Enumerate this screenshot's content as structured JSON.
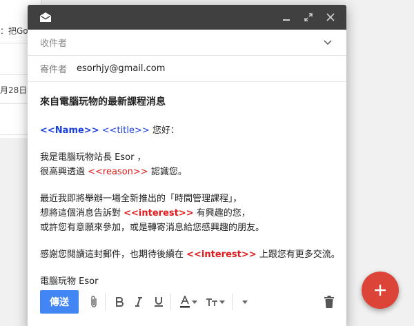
{
  "background_inbox": {
    "row1_text": "：把Go",
    "row2_text": "月28日-"
  },
  "compose": {
    "to_placeholder": "收件者",
    "from_label": "寄件者",
    "from_value": "esorhjy@gmail.com",
    "subject": "來自電腦玩物的最新課程消息",
    "greeting": {
      "name_tag": "<<Name>>",
      "title_tag": "<<title>>",
      "suffix": " 您好："
    },
    "intro": {
      "line1": "我是電腦玩物站長 Esor ，",
      "line2_prefix": "很高興透過 ",
      "reason_tag": "<<reason>>",
      "line2_suffix": " 認識您。"
    },
    "announce": {
      "line1": "最近我即將舉辦一場全新推出的「時間管理課程」，",
      "line2_prefix": "想將這個消息告訴對 ",
      "interest_tag": "<<interest>>",
      "line2_suffix": " 有興趣的您，",
      "line3": "或許您有意願來參加，或是轉寄消息給您感興趣的朋友。"
    },
    "thanks": {
      "prefix": "感謝您閱讀這封郵件，也期待後續在 ",
      "interest_tag": "<<interest>>",
      "suffix": " 上跟您有更多交流。"
    },
    "signature": "電腦玩物 Esor",
    "send_label": "傳送"
  },
  "colors": {
    "titlebar": "#404040",
    "send": "#4285f4",
    "fab": "#db4437",
    "placeholder_blue": "#1a3fe0",
    "placeholder_red": "#e01a1a"
  },
  "icons": {
    "titlebar": [
      "mail-open-icon",
      "minimize-icon",
      "expand-icon",
      "close-icon"
    ],
    "toolbar": [
      "attach-icon",
      "bold-icon",
      "italic-icon",
      "underline-icon",
      "text-color-icon",
      "text-size-icon",
      "more-options-icon",
      "trash-icon"
    ],
    "fab": "plus-icon"
  }
}
